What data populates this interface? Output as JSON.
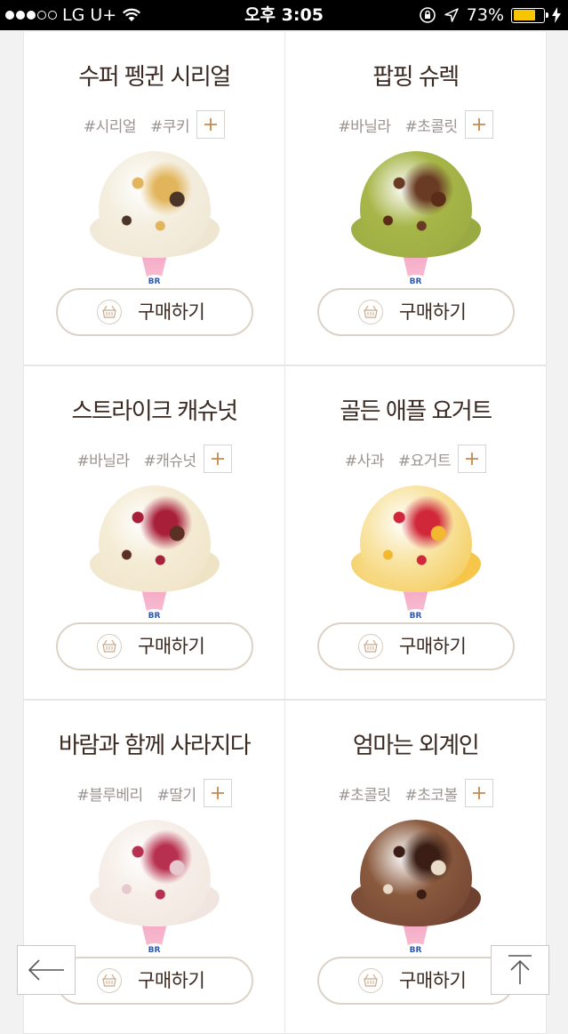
{
  "status_bar": {
    "carrier": "LG U+",
    "time": "오후 3:05",
    "battery": "73%",
    "battery_level": 0.73,
    "signal_filled": 3,
    "signal_total": 5,
    "battery_color": "#f7c600"
  },
  "products": [
    {
      "name": "수퍼 펭귄 시리얼",
      "tags": [
        "#시리얼",
        "#쿠키"
      ],
      "buy_label": "구매하기",
      "colors": {
        "main": "#f4eedf",
        "accent1": "#e2b55c",
        "accent2": "#4a3528",
        "base": "#efe6d2"
      }
    },
    {
      "name": "팝핑 슈렉",
      "tags": [
        "#바닐라",
        "#초콜릿"
      ],
      "buy_label": "구매하기",
      "colors": {
        "main": "#a7b648",
        "accent1": "#6a3b24",
        "accent2": "#5a2d18",
        "base": "#9aaa42"
      }
    },
    {
      "name": "스트라이크 캐슈넛",
      "tags": [
        "#바닐라",
        "#캐슈넛"
      ],
      "buy_label": "구매하기",
      "colors": {
        "main": "#f5ecd6",
        "accent1": "#a81f3a",
        "accent2": "#5a3024",
        "base": "#efe3c6"
      }
    },
    {
      "name": "골든 애플 요거트",
      "tags": [
        "#사과",
        "#요거트"
      ],
      "buy_label": "구매하기",
      "colors": {
        "main": "#f8e4a4",
        "accent1": "#d0283a",
        "accent2": "#f2b830",
        "base": "#f5c64a"
      }
    },
    {
      "name": "바람과 함께 사라지다",
      "tags": [
        "#블루베리",
        "#딸기"
      ],
      "buy_label": "구매하기",
      "colors": {
        "main": "#f6eee8",
        "accent1": "#b83050",
        "accent2": "#e6c8cf",
        "base": "#f1e6df"
      }
    },
    {
      "name": "엄마는 외계인",
      "tags": [
        "#초콜릿",
        "#초코볼"
      ],
      "buy_label": "구매하기",
      "colors": {
        "main": "#8a5a3e",
        "accent1": "#3a1d14",
        "accent2": "#e8dcc8",
        "base": "#6e4030"
      }
    }
  ],
  "cone_logo": "BR",
  "colors": {
    "add_tag": "#c48a4e",
    "title_text": "#3a2a22",
    "tag_text": "#9a9390",
    "button_border": "#ddd2c6"
  }
}
